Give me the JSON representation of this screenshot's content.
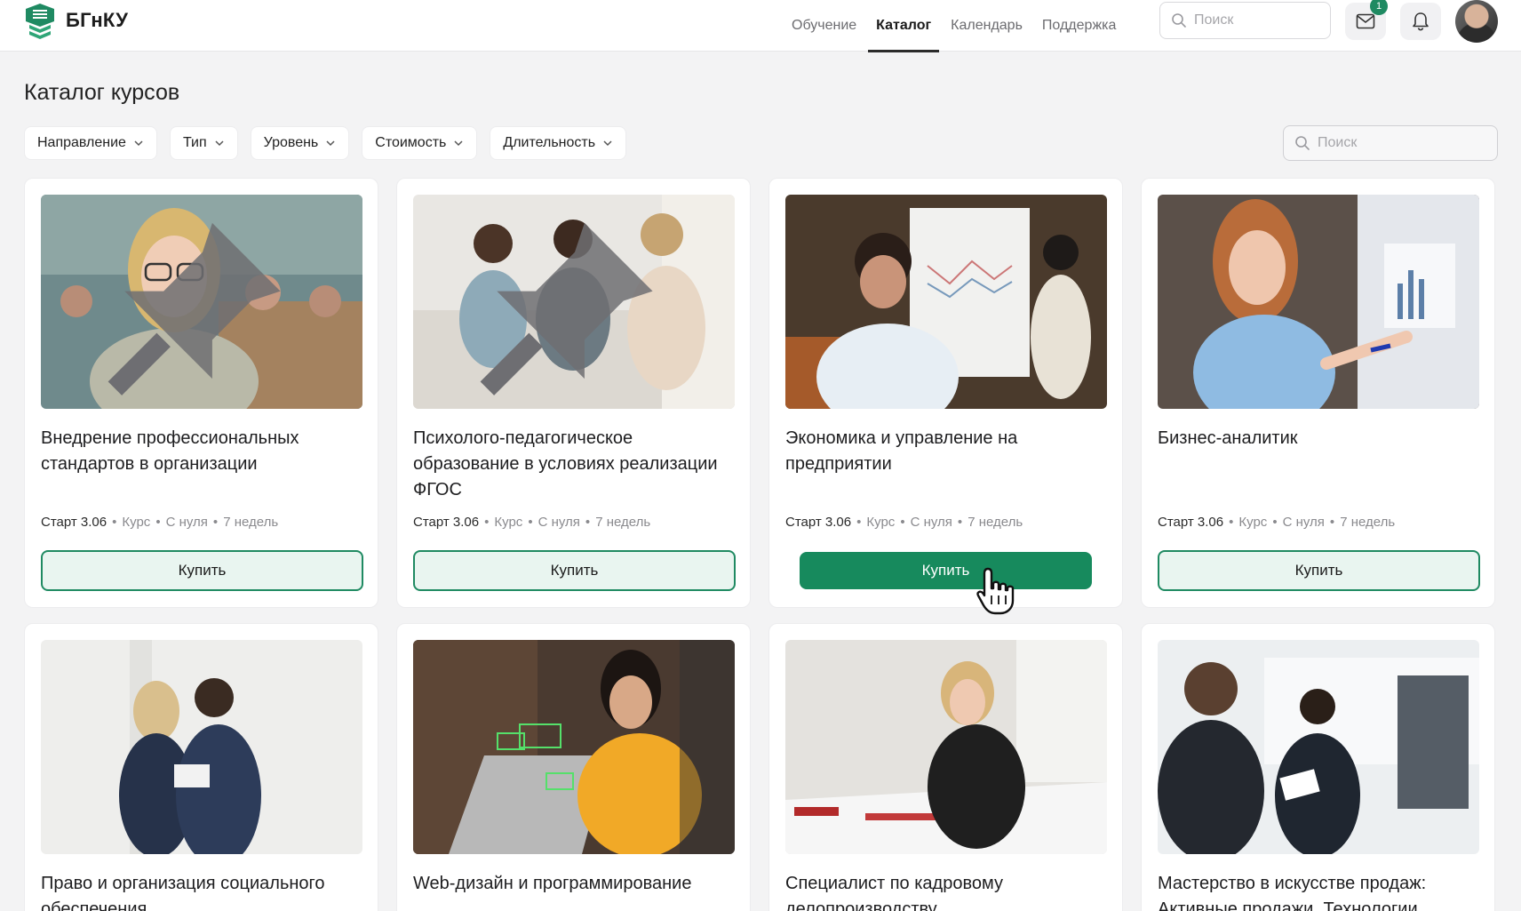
{
  "brand": {
    "name": "БГнКУ",
    "accent": "#1f8a62"
  },
  "nav": {
    "items": [
      {
        "label": "Обучение",
        "active": false
      },
      {
        "label": "Каталог",
        "active": true
      },
      {
        "label": "Календарь",
        "active": false
      },
      {
        "label": "Поддержка",
        "active": false
      }
    ]
  },
  "header": {
    "search_placeholder": "Поиск",
    "mail_badge": "1",
    "icons": [
      "search-icon",
      "mail-icon",
      "bell-icon",
      "avatar"
    ]
  },
  "page": {
    "title": "Каталог курсов"
  },
  "filters": {
    "items": [
      {
        "label": "Направление"
      },
      {
        "label": "Тип"
      },
      {
        "label": "Уровень"
      },
      {
        "label": "Стоимость"
      },
      {
        "label": "Длительность"
      }
    ],
    "search_placeholder": "Поиск"
  },
  "courses": [
    {
      "title": "Внедрение профессиональных стандартов в организации",
      "start": "Старт 3.06",
      "type": "Курс",
      "level": "С нуля",
      "duration": "7 недель",
      "button": "Купить",
      "pinned": true
    },
    {
      "title": "Психолого-педагогическое образование в условиях реализации ФГОС",
      "start": "Старт 3.06",
      "type": "Курс",
      "level": "С нуля",
      "duration": "7 недель",
      "button": "Купить",
      "pinned": true
    },
    {
      "title": "Экономика и управление на предприятии",
      "start": "Старт 3.06",
      "type": "Курс",
      "level": "С нуля",
      "duration": "7 недель",
      "button": "Купить",
      "pinned": false,
      "hovered": true
    },
    {
      "title": "Бизнес-аналитик",
      "start": "Старт 3.06",
      "type": "Курс",
      "level": "С нуля",
      "duration": "7 недель",
      "button": "Купить",
      "pinned": false
    },
    {
      "title": "Право и организация социального обеспечения"
    },
    {
      "title": "Web-дизайн и программирование"
    },
    {
      "title": "Специалист по кадровому делопроизводству"
    },
    {
      "title": "Мастерство в искусстве продаж: Активные продажи. Технологии"
    }
  ]
}
